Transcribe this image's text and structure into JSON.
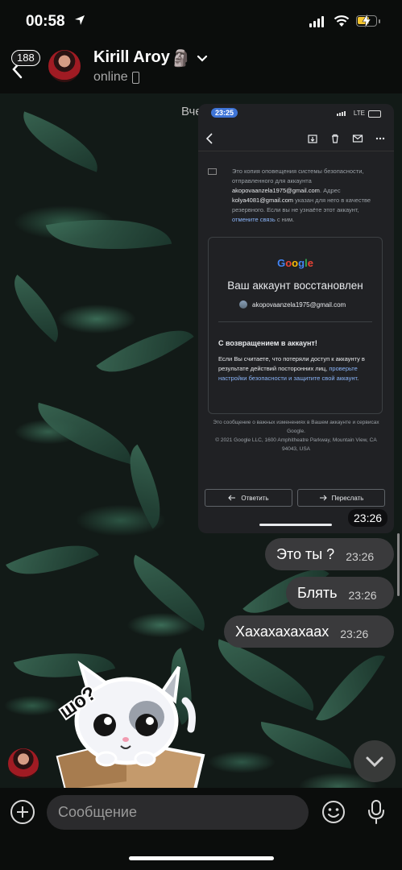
{
  "status_bar": {
    "time": "00:58"
  },
  "header": {
    "unread_count": "188",
    "contact_name": "Kirill Aroy",
    "name_emoji": "🗿",
    "status": "online"
  },
  "chat": {
    "date_label": "Вчера",
    "screenshot": {
      "phone_time": "23:25",
      "network": "LTE",
      "note_text_1": "Это копия оповещения системы безопасности, отправленного для аккаунта",
      "note_email_1": "akopovaanzela1975@gmail.com",
      "note_text_2": ". Адрес",
      "note_email_2": "kolya4081@gmail.com",
      "note_text_3": " указан для него в качестве резервного. Если вы не узнаёте этот аккаунт,",
      "note_link": "отмените связь",
      "note_text_4": " с ним.",
      "logo": [
        "G",
        "o",
        "o",
        "g",
        "l",
        "e"
      ],
      "card_title": "Ваш аккаунт восстановлен",
      "card_email": "akopovaanzela1975@gmail.com",
      "welcome": "С возвращением в аккаунт!",
      "body_text": "Если Вы считаете, что потеряли доступ к аккаунту в результате действий посторонних лиц,",
      "body_link": "проверьте настройки безопасности и защитите свой аккаунт",
      "body_end": ".",
      "footer_1": "Это сообщение о важных изменениях в Вашем аккаунте и сервисах Google.",
      "footer_2": "© 2021 Google LLC, 1600 Amphitheatre Parkway, Mountain View, CA 94043, USA",
      "reply_label": "Ответить",
      "forward_label": "Переслать",
      "timestamp": "23:26"
    },
    "messages": [
      {
        "text": "Это ты ?",
        "time": "23:26"
      },
      {
        "text": "Блять",
        "time": "23:26"
      },
      {
        "text": "Хахахахахаах",
        "time": "23:26"
      }
    ],
    "sticker_text": "шо?"
  },
  "input": {
    "placeholder": "Сообщение"
  }
}
